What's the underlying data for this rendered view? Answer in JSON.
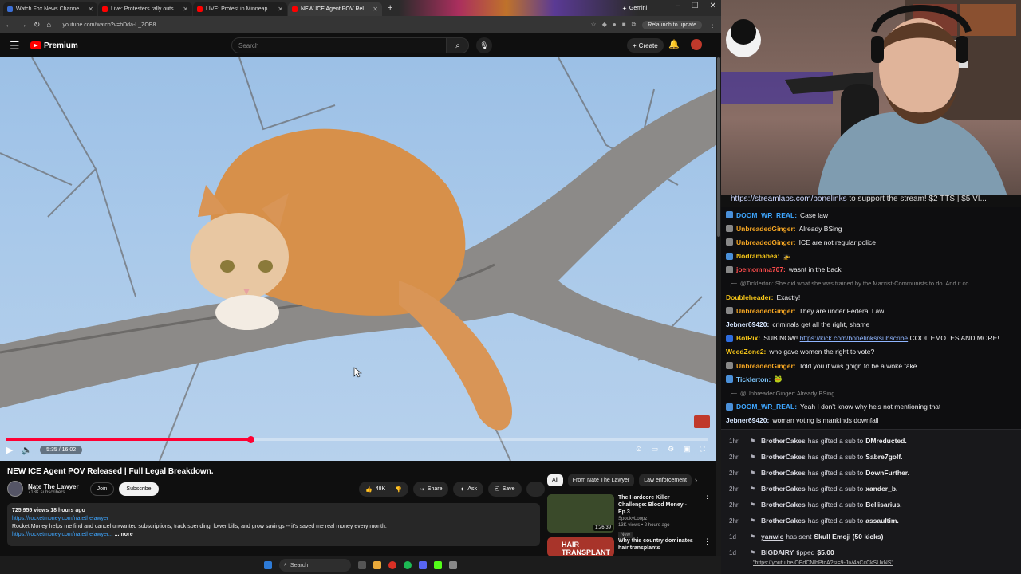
{
  "browser": {
    "tabs": [
      {
        "title": "Watch Fox News Channel O",
        "active": false
      },
      {
        "title": "Live: Protesters rally outside M",
        "active": false
      },
      {
        "title": "LIVE: Protest in Minneapolis Aft",
        "active": false
      },
      {
        "title": "NEW ICE Agent POV Released",
        "active": true
      }
    ],
    "gemini_tab": "Gemini",
    "url": "youtube.com/watch?v=bDda-L_ZOE8",
    "relaunch": "Relaunch to update"
  },
  "youtube": {
    "logo": "Premium",
    "search_placeholder": "Search",
    "create": "Create",
    "video": {
      "time": "5:35 / 16:02",
      "progress": 0.348
    },
    "title": "NEW ICE Agent POV Released | Full Legal Breakdown.",
    "channel": {
      "name": "Nate The Lawyer",
      "subs": "718K subscribers",
      "join": "Join",
      "subscribe": "Subscribe"
    },
    "actions": {
      "likes": "48K",
      "share": "Share",
      "ask": "Ask",
      "save": "Save"
    },
    "description": {
      "stats": "725,955 views  18 hours ago",
      "link1": "https://rocketmoney.com/natethelawyer",
      "text": "Rocket Money helps me find and cancel unwanted subscriptions, track spending, lower bills, and grow savings -- it's saved me real money every month.",
      "link2": "https://rocketmoney.com/natethelawyer...",
      "more": "...more"
    },
    "chips": [
      "All",
      "From Nate The Lawyer",
      "Law enforcement"
    ],
    "recs": [
      {
        "title": "The Hardcore Killer Challenge: Blood Money - Ep.3",
        "channel": "SpookyLoopz",
        "meta": "13K views • 2 hours ago",
        "badge": "New",
        "duration": "1:26:39",
        "thumb": "#3a4a2a"
      },
      {
        "title": "Why this country dominates hair transplants",
        "channel": "",
        "meta": "",
        "badge": "",
        "duration": "",
        "thumb": "#a8342a",
        "thumb_text": "HAIR TRANSPLANT"
      }
    ]
  },
  "stream": {
    "ticker_link": "https://streamlabs.com/bonelinks",
    "ticker_text": " to support the stream! $2 TTS | $5 VI..."
  },
  "chat": [
    {
      "user": "DOOM_WR_REAL:",
      "text": "Case law",
      "color": "#3ea6ff",
      "badge": "#4a90d9"
    },
    {
      "user": "UnbreadedGinger:",
      "text": "Already BSing",
      "color": "#f5a623",
      "badge": "#888"
    },
    {
      "user": "UnbreadedGinger:",
      "text": "ICE are not regular police",
      "color": "#f5a623",
      "badge": "#888"
    },
    {
      "user": "Nodramahea:",
      "text": "🚁",
      "color": "#f5c518",
      "badge": "#4a90d9"
    },
    {
      "user": "joemomma707:",
      "text": "wasnt in the back",
      "color": "#ff4d4d",
      "badge": "#888"
    },
    {
      "reply": "@Ticklerton: She did what she was trained by the Marxist-Communists to do. And it co..."
    },
    {
      "user": "Doubleheader:",
      "text": "Exactly!",
      "color": "#f5c518",
      "badge": ""
    },
    {
      "user": "UnbreadedGinger:",
      "text": "They are under Federal Law",
      "color": "#f5a623",
      "badge": "#888"
    },
    {
      "user": "Jebner69420:",
      "text": "criminals get all the right, shame",
      "color": "#d6e6ff",
      "badge": ""
    },
    {
      "user": "BotRix:",
      "text": "SUB NOW! ",
      "link": "https://kick.com/bonelinks/subscribe",
      "after": " COOL EMOTES AND MORE!",
      "color": "#f5c518",
      "badge": "#2d6cdf"
    },
    {
      "user": "WeedZone2:",
      "text": "who gave women the right to vote?",
      "color": "#f5c518",
      "badge": ""
    },
    {
      "user": "UnbreadedGinger:",
      "text": "Told you it was goign to be a woke take",
      "color": "#f5a623",
      "badge": "#888"
    },
    {
      "user": "Ticklerton:",
      "text": "🐸",
      "color": "#7ec8ff",
      "badge": "#4a90d9"
    },
    {
      "reply": "@UnbreadedGinger: Already BSing"
    },
    {
      "user": "DOOM_WR_REAL:",
      "text": "Yeah I don't know why he's not mentioning that",
      "color": "#3ea6ff",
      "badge": "#4a90d9"
    },
    {
      "user": "Jebner69420:",
      "text": "woman voting is mankinds downfall",
      "color": "#d6e6ff",
      "badge": ""
    }
  ],
  "gifts": [
    {
      "ago": "1hr",
      "user": "BrotherCakes",
      "text": "has gifted a sub to",
      "target": "DMreducted."
    },
    {
      "ago": "2hr",
      "user": "BrotherCakes",
      "text": "has gifted a sub to",
      "target": "Sabre7golf."
    },
    {
      "ago": "2hr",
      "user": "BrotherCakes",
      "text": "has gifted a sub to",
      "target": "DownFurther."
    },
    {
      "ago": "2hr",
      "user": "BrotherCakes",
      "text": "has gifted a sub to",
      "target": "xander_b."
    },
    {
      "ago": "2hr",
      "user": "BrotherCakes",
      "text": "has gifted a sub to",
      "target": "Bellisarius."
    },
    {
      "ago": "2hr",
      "user": "BrotherCakes",
      "text": "has gifted a sub to",
      "target": "assaultim."
    },
    {
      "ago": "1d",
      "user": "yanwic",
      "text": "has sent",
      "target": "Skull Emoji (50 kicks)"
    },
    {
      "ago": "1d",
      "user": "BIGDAIRY",
      "text": "tipped",
      "target": "$5.00"
    }
  ],
  "gift_link": "\"https://youtu.be/OEdCNlhPtcA?si=9-JiV4aCcCkSUxNS\"",
  "taskbar": {
    "search": "Search"
  }
}
